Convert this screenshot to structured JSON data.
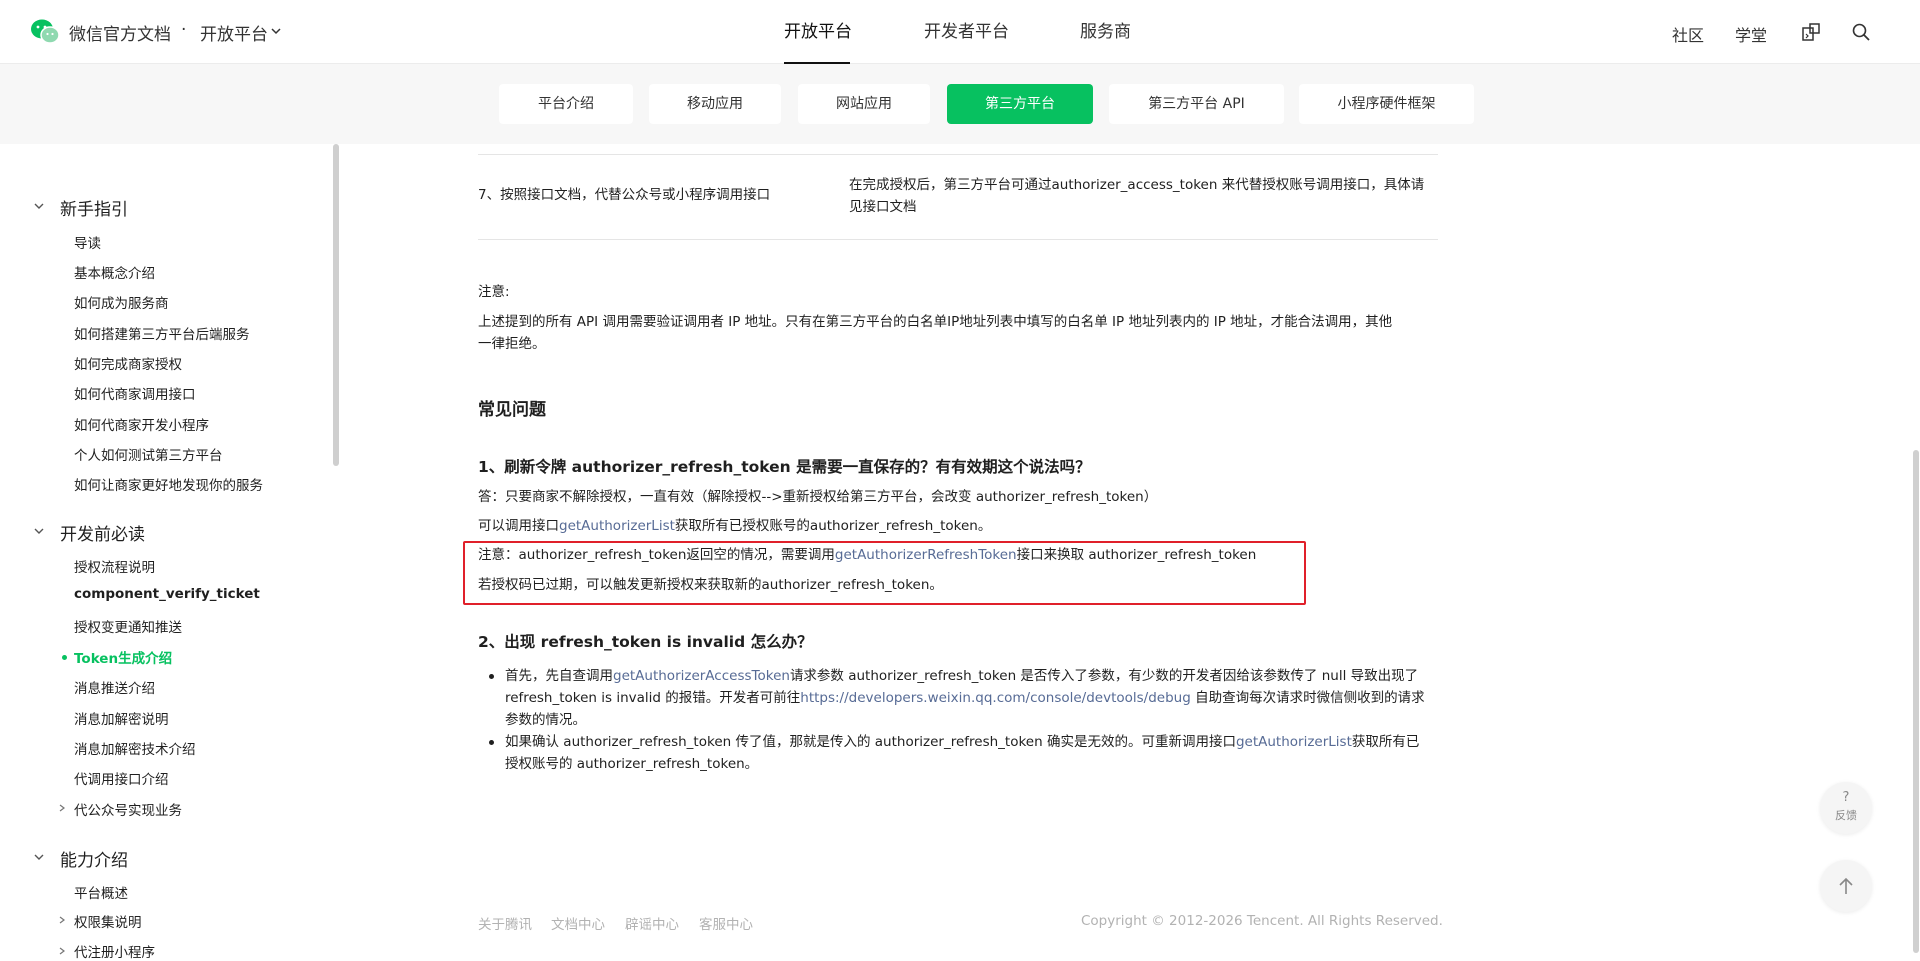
{
  "header": {
    "brand": "微信官方文档",
    "dot": "·",
    "section": "开放平台",
    "nav": [
      "开放平台",
      "开发者平台",
      "服务商"
    ],
    "tools": [
      "社区",
      "学堂"
    ]
  },
  "subtabs": [
    "平台介绍",
    "移动应用",
    "网站应用",
    "第三方平台",
    "第三方平台 API",
    "小程序硬件框架"
  ],
  "sidebar": {
    "groups": [
      {
        "label": "新手指引"
      },
      {
        "label": "开发前必读"
      },
      {
        "label": "能力介绍"
      }
    ],
    "items_g1": [
      "导读",
      "基本概念介绍",
      "如何成为服务商",
      "如何搭建第三方平台后端服务",
      "如何完成商家授权",
      "如何代商家调用接口",
      "如何代商家开发小程序",
      "个人如何测试第三方平台",
      "如何让商家更好地发现你的服务"
    ],
    "items_g2": [
      "授权流程说明",
      "component_verify_ticket",
      "授权变更通知推送",
      "Token生成介绍",
      "消息推送介绍",
      "消息加解密说明",
      "消息加解密技术介绍",
      "代调用接口介绍",
      "代公众号实现业务"
    ],
    "items_g3": [
      "平台概述",
      "权限集说明",
      "代注册小程序"
    ]
  },
  "content": {
    "row7_left": "7、按照接口文档，代替公众号或小程序调用接口",
    "row7_right_1": "在完成授权后，第三方平台可通过authorizer_access_token 来代替授权账号调用接口，具体请",
    "row7_right_2": "见接口文档",
    "note_label": "注意:",
    "note_text_1": "上述提到的所有 API 调用需要验证调用者 IP 地址。只有在第三方平台的白名单IP地址列表中填写的白名单 IP 地址列表内的 IP 地址，才能合法调用，其他",
    "note_text_2": "一律拒绝。",
    "faq_title": "常见问题",
    "q1_title": "1、刷新令牌 authorizer_refresh_token 是需要一直保存的？有有效期这个说法吗？",
    "q1_a1": "答：只要商家不解除授权，一直有效（解除授权-->重新授权给第三方平台，会改变 authorizer_refresh_token）",
    "q1_a2_pre": "可以调用接口",
    "q1_a2_link": "getAuthorizerList",
    "q1_a2_post": "获取所有已授权账号的authorizer_refresh_token。",
    "q1_n1_pre": "注意：authorizer_refresh_token返回空的情况，需要调用",
    "q1_n1_link": "getAuthorizerRefreshToken",
    "q1_n1_post": "接口来换取 authorizer_refresh_token",
    "q1_n2": "若授权码已过期，可以触发更新授权来获取新的authorizer_refresh_token。",
    "q2_title": "2、出现 refresh_token is invalid 怎么办？",
    "b1_l1_pre": "首先，先自查调用",
    "b1_l1_link": "getAuthorizerAccessToken",
    "b1_l1_post": "请求参数 authorizer_refresh_token 是否传入了参数，有少数的开发者因给该参数传了 null 导致出现了",
    "b1_l2_pre": "refresh_token is invalid 的报错。开发者可前往",
    "b1_l2_link": "https://developers.weixin.qq.com/console/devtools/debug",
    "b1_l2_post": " 自助查询每次请求时微信侧收到的请求",
    "b1_l3": "参数的情况。",
    "b2_l1_pre": "如果确认 authorizer_refresh_token 传了值，那就是传入的 authorizer_refresh_token 确实是无效的。可重新调用接口",
    "b2_l1_link": "getAuthorizerList",
    "b2_l1_post": "获取所有已",
    "b2_l2": "授权账号的 authorizer_refresh_token。"
  },
  "footer": {
    "links": [
      "关于腾讯",
      "文档中心",
      "辟谣中心",
      "客服中心"
    ],
    "copyright": "Copyright © 2012-2026 Tencent. All Rights Reserved."
  },
  "float": {
    "feedback_q": "?",
    "feedback_label": "反馈"
  },
  "colors": {
    "accent": "#07c160",
    "link": "#576b95",
    "highlight_box": "#e0202a"
  }
}
